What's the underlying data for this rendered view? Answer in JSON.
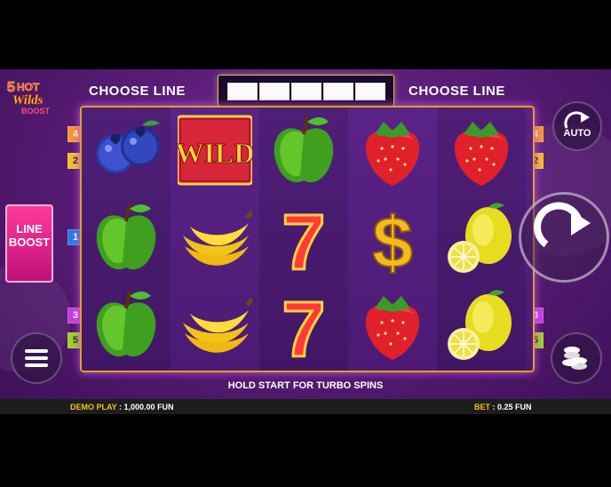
{
  "logo": {
    "text": "5 HOT Wilds BOOST"
  },
  "choose_line_left": "CHOOSE LINE",
  "choose_line_right": "CHOOSE LINE",
  "line_boost": {
    "line1": "LINE",
    "line2": "BOOST"
  },
  "auto_label": "AUTO",
  "hold_text": "HOLD START FOR TURBO SPINS",
  "status": {
    "demo_label": "DEMO PLAY",
    "demo_value": ": 1,000.00 FUN",
    "bet_label": "BET",
    "bet_value": ": 0.25 FUN"
  },
  "left_lines": [
    "4",
    "2",
    "1",
    "3",
    "5"
  ],
  "right_lines": [
    "4",
    "2",
    "3",
    "5"
  ],
  "reels": [
    [
      "blueberry",
      "apple",
      "apple"
    ],
    [
      "wild",
      "banana",
      "banana"
    ],
    [
      "apple",
      "seven",
      "seven"
    ],
    [
      "strawberry",
      "dollar",
      "strawberry"
    ],
    [
      "strawberry",
      "lemon",
      "lemon"
    ]
  ],
  "wild_text": "WILD",
  "icons": {
    "autoplay": "autoplay-arrow-icon",
    "spin": "spin-icon",
    "menu": "menu-icon",
    "chips": "coin-stack-icon"
  }
}
